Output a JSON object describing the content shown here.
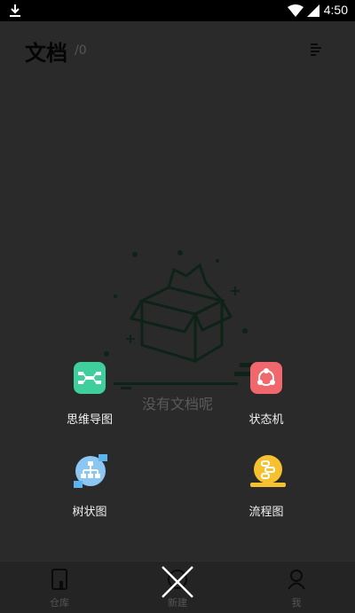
{
  "status_bar": {
    "time": "4:50"
  },
  "header": {
    "title": "文档",
    "count": "/0"
  },
  "empty": {
    "text": "没有文档呢"
  },
  "menu": {
    "mind_map": "思维导图",
    "state_machine": "状态机",
    "tree": "树状图",
    "flowchart": "流程图"
  },
  "nav": {
    "repo": "仓库",
    "new": "新建",
    "me": "我"
  },
  "colors": {
    "mind_map": "#3ecf9c",
    "state_machine": "#f0686e",
    "tree": "#5ab4ee",
    "flowchart": "#f6c02e"
  }
}
